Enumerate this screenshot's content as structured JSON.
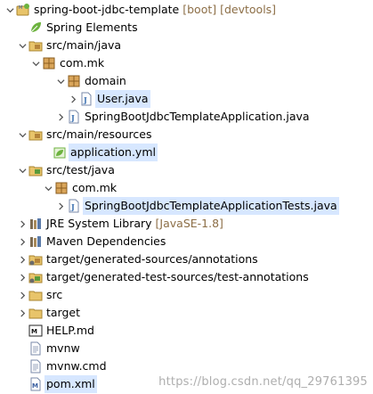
{
  "tree": {
    "project": {
      "name": "spring-boot-jdbc-template",
      "decorations": "[boot] [devtools]"
    },
    "spring_elements": "Spring Elements",
    "src_main_java": "src/main/java",
    "pkg_com_mk": "com.mk",
    "pkg_domain": "domain",
    "file_user": "User.java",
    "file_app": "SpringBootJdbcTemplateApplication.java",
    "src_main_resources": "src/main/resources",
    "file_app_yml": "application.yml",
    "src_test_java": "src/test/java",
    "pkg_com_mk_test": "com.mk",
    "file_app_tests": "SpringBootJdbcTemplateApplicationTests.java",
    "jre": {
      "name": "JRE System Library",
      "decorations": "[JavaSE-1.8]"
    },
    "maven_deps": "Maven Dependencies",
    "gen_sources": "target/generated-sources/annotations",
    "gen_test_sources": "target/generated-test-sources/test-annotations",
    "folder_src": "src",
    "folder_target": "target",
    "file_help": "HELP.md",
    "file_mvnw": "mvnw",
    "file_mvnw_cmd": "mvnw.cmd",
    "file_pom": "pom.xml"
  },
  "watermark": "https://blog.csdn.net/qq_29761395",
  "colors": {
    "decoration": "#8c6e46",
    "selection": "#d7e7ff",
    "folder": "#e8c46a",
    "package": "#b5843a"
  }
}
